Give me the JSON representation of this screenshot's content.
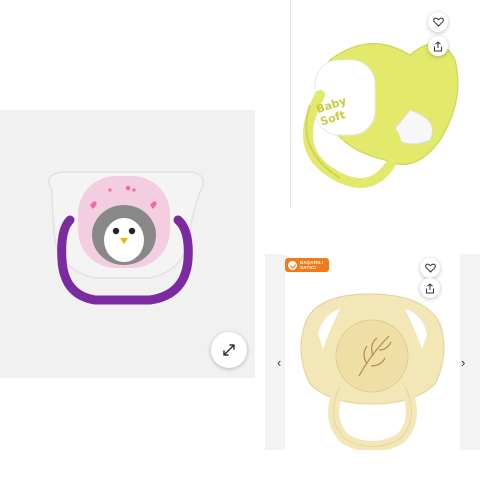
{
  "left_panel": {
    "product": "pink penguin orthodontic pacifier with purple handle",
    "expand_button_icon": "expand-arrows-icon"
  },
  "top_right_panel": {
    "product": "yellow pacifier",
    "brand_logo_text": "Baby Soft",
    "favorite_icon": "heart-icon",
    "share_icon": "share-icon"
  },
  "bottom_right_panel": {
    "badge": {
      "line1": "BAŞARILI",
      "line2": "SATICI"
    },
    "product": "cream pacifier with leaf engraving",
    "favorite_icon": "heart-icon",
    "share_icon": "share-icon",
    "prev_arrow": "‹",
    "next_arrow": "›"
  },
  "colors": {
    "badge_orange": "#f27a1a",
    "purple_handle": "#7b2aa0",
    "yellow": "#e3e96a",
    "cream": "#f3e7b8"
  }
}
